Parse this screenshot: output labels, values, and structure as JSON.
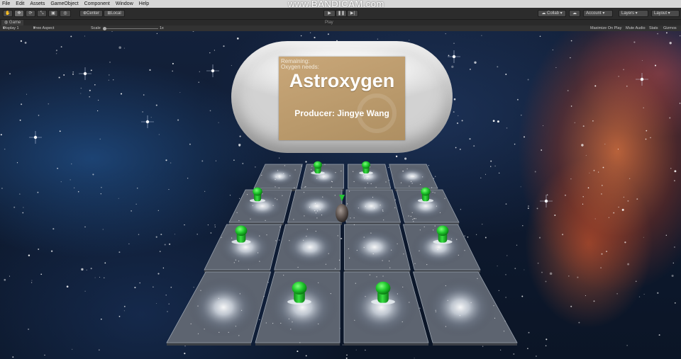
{
  "menu": {
    "items": [
      "File",
      "Edit",
      "Assets",
      "GameObject",
      "Component",
      "Window",
      "Help"
    ]
  },
  "watermark": "www.BANDICAM.com",
  "toolbar": {
    "transform_tools": [
      "hand-tool",
      "move-tool",
      "rotate-tool",
      "scale-tool",
      "rect-tool",
      "custom-tool"
    ],
    "pivot_label": "Center",
    "space_label": "Local",
    "collab_label": "Collab",
    "account_label": "Account",
    "layers_label": "Layers",
    "layout_label": "Layout"
  },
  "game_tab": {
    "tab_label": "Game",
    "play_caption": "Play",
    "display_label": "Display 1",
    "aspect_label": "Free Aspect",
    "scale_label": "Scale",
    "scale_value": "1x",
    "maximize_label": "Maximize On Play",
    "mute_label": "Mute Audio",
    "stats_label": "Stats",
    "gizmos_label": "Gizmos"
  },
  "game": {
    "remaining_label": "Remaining:",
    "oxygen_label": "Oxygen needs:",
    "title": "Astroxygen",
    "producer": "Producer: Jingye Wang"
  },
  "colors": {
    "sign_background": "#b9996b",
    "pawn_green": "#1fc72c",
    "editor_dark": "#2c2c2c",
    "menubar": "#d6d6d6"
  }
}
